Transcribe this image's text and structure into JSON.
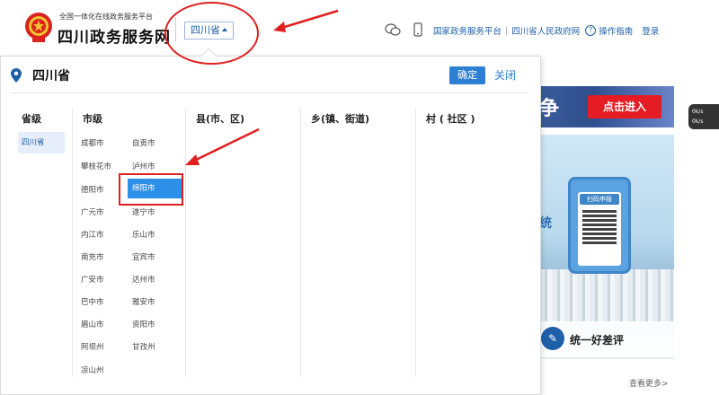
{
  "header": {
    "logo_subtitle": "全国一体化在线政务服务平台",
    "logo_title": "四川政务服务网",
    "province_selector": "四川省",
    "links": {
      "national": "国家政务服务平台",
      "separator": "|",
      "provincial_gov": "四川省人民政府网",
      "help_mark": "?",
      "guide": "操作指南",
      "login": "登录"
    }
  },
  "panel": {
    "title": "四川省",
    "confirm": "确定",
    "close": "关闭",
    "columns": {
      "province": "省级",
      "city": "市级",
      "county": "县(市、区)",
      "town": "乡(镇、街道)",
      "village": "村 ( 社区 )"
    },
    "province_selected": "四川省",
    "cities": [
      "成都市",
      "自贡市",
      "攀枝花市",
      "泸州市",
      "德阳市",
      "绵阳市",
      "广元市",
      "遂宁市",
      "内江市",
      "乐山市",
      "南充市",
      "宜宾市",
      "广安市",
      "达州市",
      "巴中市",
      "雅安市",
      "眉山市",
      "资阳市",
      "阿坝州",
      "甘孜州",
      "凉山州"
    ],
    "selected_city": "绵阳市"
  },
  "background": {
    "banner_text": "争",
    "enter_button": "点击进入",
    "speed_up": "0k/s",
    "speed_down": "0k/s",
    "scan_label": "扫码申报",
    "tong": "统",
    "eval_text": "统一好差评",
    "see_more": "查看更多>"
  },
  "colors": {
    "accent": "#2d8fe8",
    "annotation": "#e02020",
    "link": "#1f5fa8"
  }
}
